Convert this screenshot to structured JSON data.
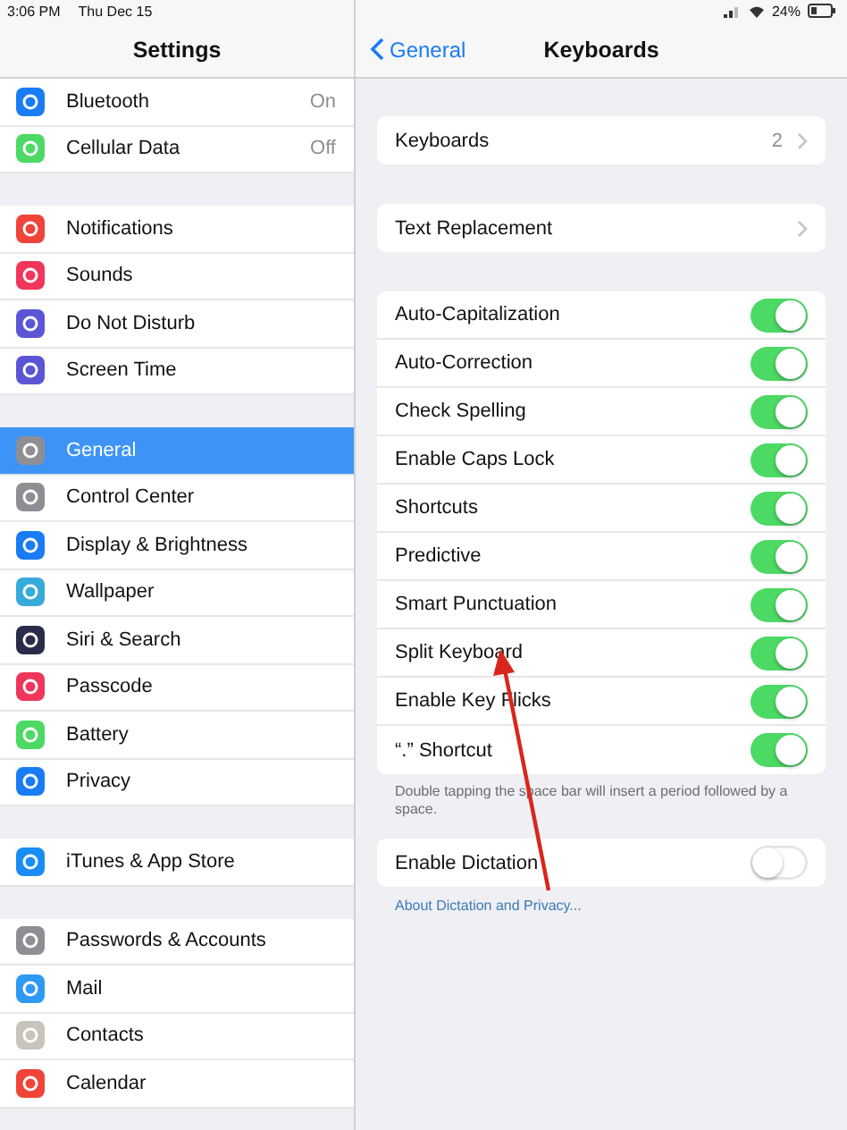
{
  "status_bar": {
    "time": "3:06 PM",
    "date": "Thu Dec 15",
    "battery": "24%"
  },
  "sidebar": {
    "title": "Settings",
    "groups": [
      [
        {
          "label": "Bluetooth",
          "value": "On",
          "selected": false
        },
        {
          "label": "Cellular Data",
          "value": "Off",
          "selected": false
        }
      ],
      [
        {
          "label": "Notifications",
          "selected": false
        },
        {
          "label": "Sounds",
          "selected": false
        },
        {
          "label": "Do Not Disturb",
          "selected": false
        },
        {
          "label": "Screen Time",
          "selected": false
        }
      ],
      [
        {
          "label": "General",
          "selected": true
        },
        {
          "label": "Control Center",
          "selected": false
        },
        {
          "label": "Display & Brightness",
          "selected": false
        },
        {
          "label": "Wallpaper",
          "selected": false
        },
        {
          "label": "Siri & Search",
          "selected": false
        },
        {
          "label": "Passcode",
          "selected": false
        },
        {
          "label": "Battery",
          "selected": false
        },
        {
          "label": "Privacy",
          "selected": false
        }
      ],
      [
        {
          "label": "iTunes & App Store",
          "selected": false
        }
      ],
      [
        {
          "label": "Passwords & Accounts",
          "selected": false
        },
        {
          "label": "Mail",
          "selected": false
        },
        {
          "label": "Contacts",
          "selected": false
        },
        {
          "label": "Calendar",
          "selected": false
        }
      ]
    ]
  },
  "detail": {
    "back": "General",
    "title": "Keyboards",
    "links": [
      {
        "label": "Keyboards",
        "value": "2"
      },
      {
        "label": "Text Replacement"
      }
    ],
    "toggles": [
      {
        "label": "Auto-Capitalization",
        "on": true
      },
      {
        "label": "Auto-Correction",
        "on": true
      },
      {
        "label": "Check Spelling",
        "on": true
      },
      {
        "label": "Enable Caps Lock",
        "on": true
      },
      {
        "label": "Shortcuts",
        "on": true
      },
      {
        "label": "Predictive",
        "on": true
      },
      {
        "label": "Smart Punctuation",
        "on": true
      },
      {
        "label": "Split Keyboard",
        "on": true
      },
      {
        "label": "Enable Key Flicks",
        "on": true
      },
      {
        "label": "“.” Shortcut",
        "on": true
      }
    ],
    "toggles_note": "Double tapping the space bar will insert a period followed by a space.",
    "dictation": {
      "label": "Enable Dictation",
      "on": false
    },
    "dictation_link": "About Dictation and Privacy..."
  }
}
